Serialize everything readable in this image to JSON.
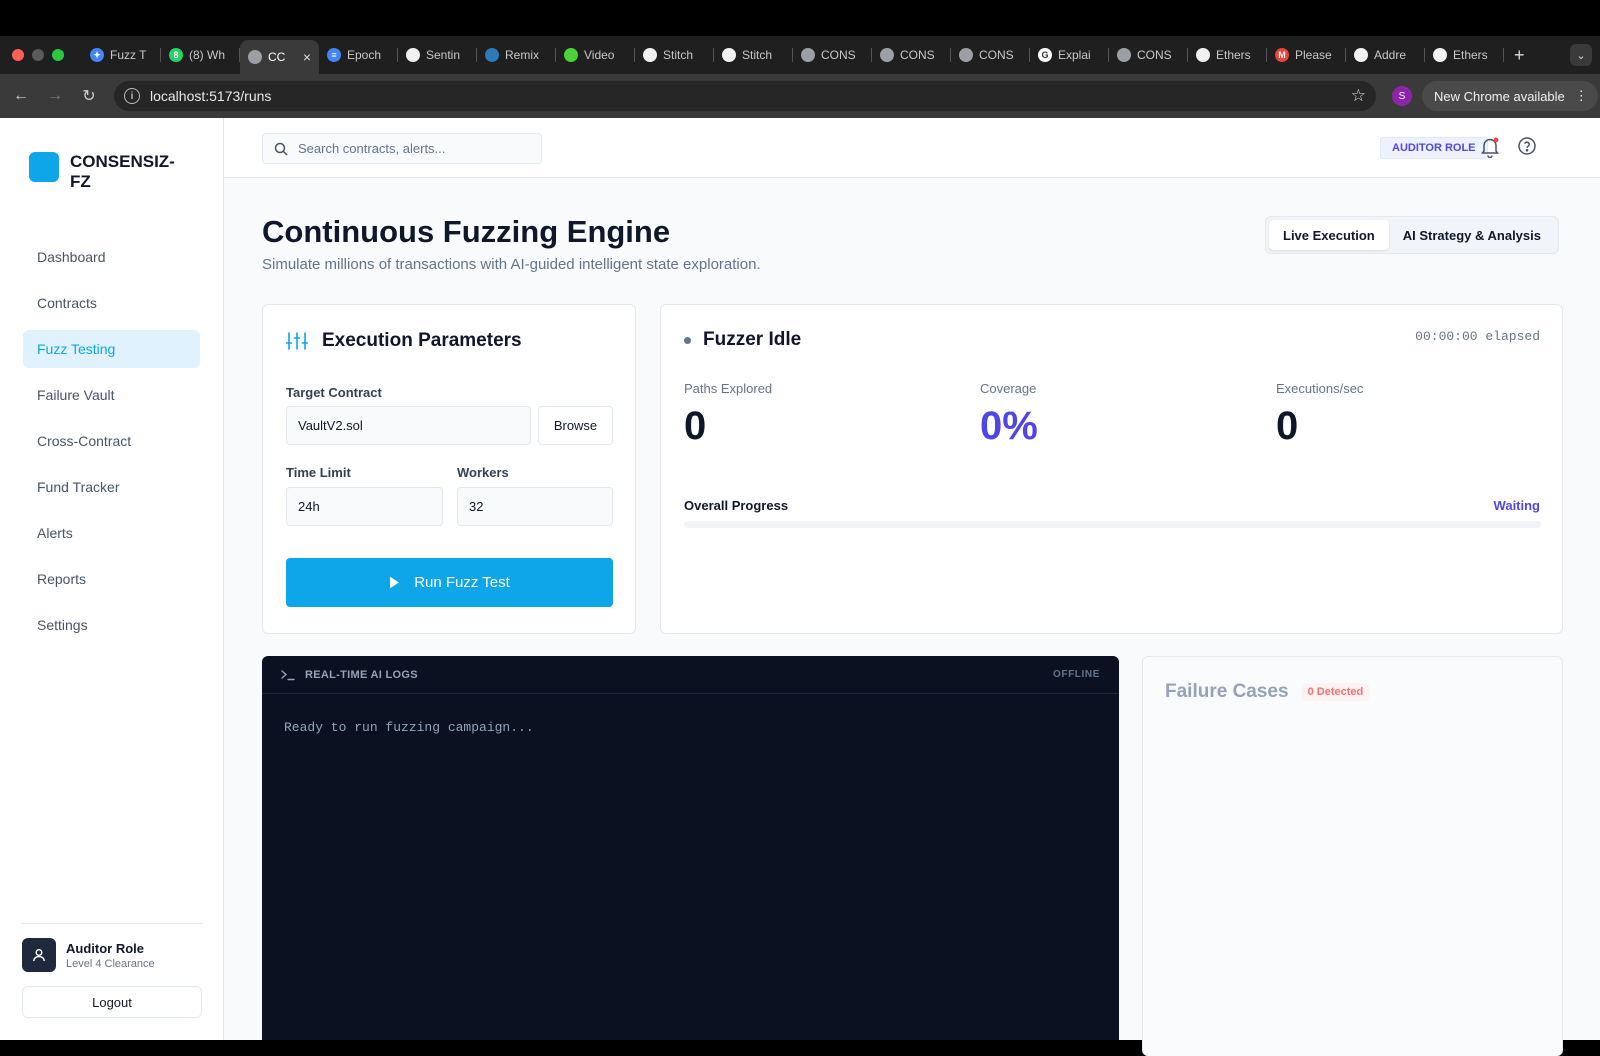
{
  "browser": {
    "tabs": [
      {
        "title": "Fuzz T",
        "color": "#4285f4",
        "glyph": "✦"
      },
      {
        "title": "(8) Wh",
        "color": "#25d366",
        "glyph": "8"
      },
      {
        "title": "CC",
        "color": "#9aa0a6",
        "glyph": "",
        "active": true
      },
      {
        "title": "Epoch",
        "color": "#4285f4",
        "glyph": "≡"
      },
      {
        "title": "Sentin",
        "color": "#f1f1f1",
        "glyph": ""
      },
      {
        "title": "Remix",
        "color": "#2b7bb9",
        "glyph": ""
      },
      {
        "title": "Video",
        "color": "#4cd137",
        "glyph": ""
      },
      {
        "title": "Stitch",
        "color": "#f1f1f1",
        "glyph": ""
      },
      {
        "title": "Stitch",
        "color": "#f1f1f1",
        "glyph": ""
      },
      {
        "title": "CONS",
        "color": "#9aa0a6",
        "glyph": ""
      },
      {
        "title": "CONS",
        "color": "#9aa0a6",
        "glyph": ""
      },
      {
        "title": "CONS",
        "color": "#9aa0a6",
        "glyph": ""
      },
      {
        "title": "Explai",
        "color": "#ffffff",
        "glyph": "G"
      },
      {
        "title": "CONS",
        "color": "#9aa0a6",
        "glyph": ""
      },
      {
        "title": "Ethers",
        "color": "#f1f1f1",
        "glyph": ""
      },
      {
        "title": "Please",
        "color": "#ea4335",
        "glyph": "M"
      },
      {
        "title": "Addre",
        "color": "#f1f1f1",
        "glyph": ""
      },
      {
        "title": "Ethers",
        "color": "#f1f1f1",
        "glyph": ""
      }
    ],
    "new_tab": "+",
    "url": "localhost:5173/runs",
    "profile_initial": "S",
    "update_label": "New Chrome available"
  },
  "brand": {
    "name": "CONSENSIZ-FZ",
    "color": "#0ea5e9"
  },
  "nav": {
    "items": [
      {
        "label": "Dashboard"
      },
      {
        "label": "Contracts"
      },
      {
        "label": "Fuzz Testing",
        "active": true
      },
      {
        "label": "Failure Vault"
      },
      {
        "label": "Cross-Contract"
      },
      {
        "label": "Fund Tracker"
      },
      {
        "label": "Alerts"
      },
      {
        "label": "Reports"
      },
      {
        "label": "Settings"
      }
    ]
  },
  "user": {
    "name": "Auditor Role",
    "clearance": "Level 4 Clearance",
    "logout_label": "Logout"
  },
  "topbar": {
    "search_placeholder": "Search contracts, alerts...",
    "role_badge": "AUDITOR ROLE"
  },
  "page": {
    "title": "Continuous Fuzzing Engine",
    "subtitle": "Simulate millions of transactions with AI-guided intelligent state exploration.",
    "tabs": {
      "live": "Live Execution",
      "ai": "AI Strategy & Analysis"
    }
  },
  "params": {
    "title": "Execution Parameters",
    "target_label": "Target Contract",
    "target_value": "VaultV2.sol",
    "browse_label": "Browse",
    "time_label": "Time Limit",
    "time_value": "24h",
    "workers_label": "Workers",
    "workers_value": "32",
    "run_label": "Run Fuzz Test"
  },
  "status": {
    "title": "Fuzzer Idle",
    "elapsed": "00:00:00 elapsed",
    "paths_label": "Paths Explored",
    "paths_value": "0",
    "coverage_label": "Coverage",
    "coverage_value": "0%",
    "eps_label": "Executions/sec",
    "eps_value": "0",
    "progress_label": "Overall Progress",
    "progress_status": "Waiting",
    "progress_fraction": 0
  },
  "logs": {
    "title": "REAL-TIME AI LOGS",
    "state": "OFFLINE",
    "message": "Ready to run fuzzing campaign..."
  },
  "failures": {
    "title": "Failure Cases",
    "badge": "0 Detected"
  }
}
